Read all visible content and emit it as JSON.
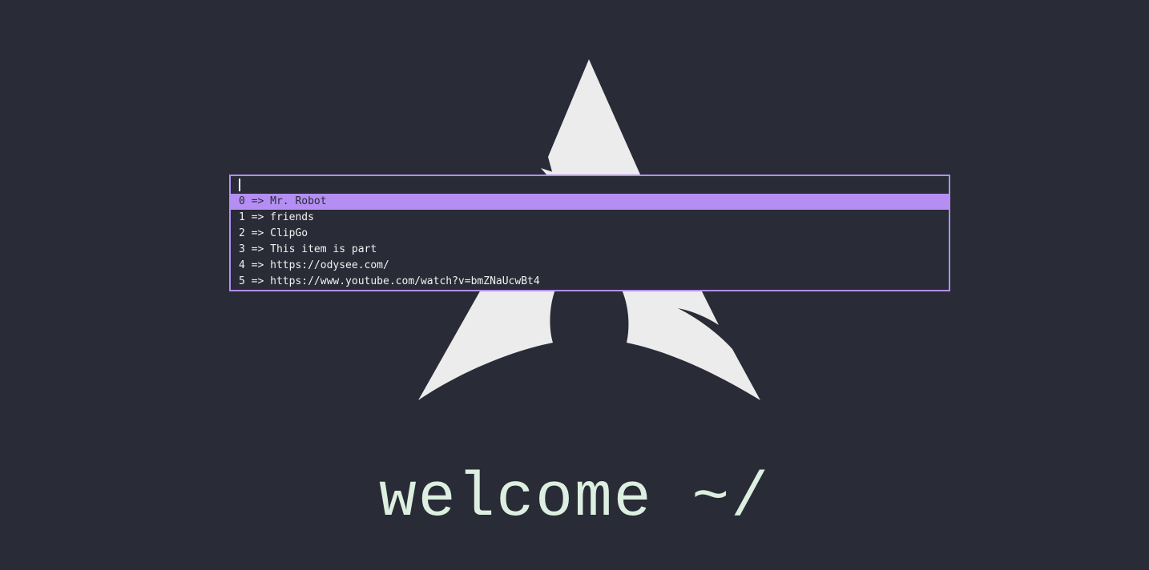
{
  "launcher": {
    "input": {
      "value": "",
      "placeholder": ""
    },
    "items": [
      {
        "label": "0 => Mr. Robot",
        "selected": true
      },
      {
        "label": "1 => friends",
        "selected": false
      },
      {
        "label": "2 => ClipGo",
        "selected": false
      },
      {
        "label": "3 => This item is part",
        "selected": false
      },
      {
        "label": "4 => https://odysee.com/",
        "selected": false
      },
      {
        "label": "5 => https://www.youtube.com/watch?v=bmZNaUcwBt4",
        "selected": false
      }
    ]
  },
  "wallpaper": {
    "logo_icon": "arch-linux-logo-icon",
    "text": "welcome ~/"
  },
  "colors": {
    "background": "#292b36",
    "accent": "#b48ef2",
    "logo": "#ececec",
    "welcome_text": "#dcefe0"
  }
}
